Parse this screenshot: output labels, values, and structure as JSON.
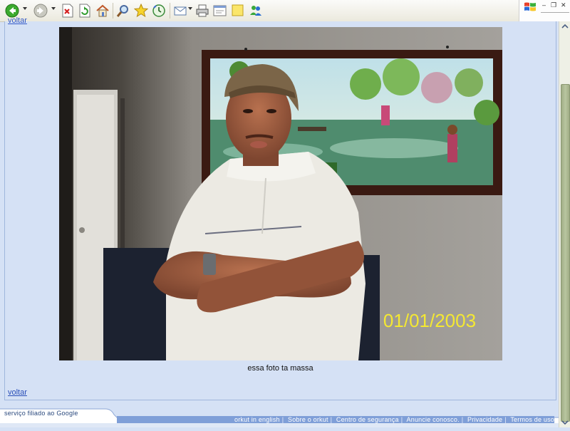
{
  "toolbar": {
    "icons": [
      "back-icon",
      "forward-icon",
      "stop-icon",
      "refresh-icon",
      "home-icon",
      "search-icon",
      "favorites-icon",
      "history-icon",
      "mail-icon",
      "print-icon",
      "edit-icon",
      "discuss-icon",
      "messenger-icon"
    ]
  },
  "window": {
    "minimize": "–",
    "restore": "❐",
    "close": "✕"
  },
  "content": {
    "top_link": "voltar",
    "photo_date_stamp": "01/01/2003",
    "caption": "essa foto ta massa",
    "bottom_link": "voltar"
  },
  "footer": {
    "google_label": "serviço filiado ao Google",
    "links": [
      "orkut in english",
      "Sobre o orkut",
      "Centro de segurança",
      "Anuncie conosco.",
      "Privacidade",
      "Termos de uso"
    ]
  },
  "colors": {
    "page_bg": "#d5e1f5",
    "link": "#3359c7",
    "footer_bar": "#7f9fd8",
    "scroll_thumb": "#b9c6a0",
    "date_stamp": "#f4e832"
  }
}
